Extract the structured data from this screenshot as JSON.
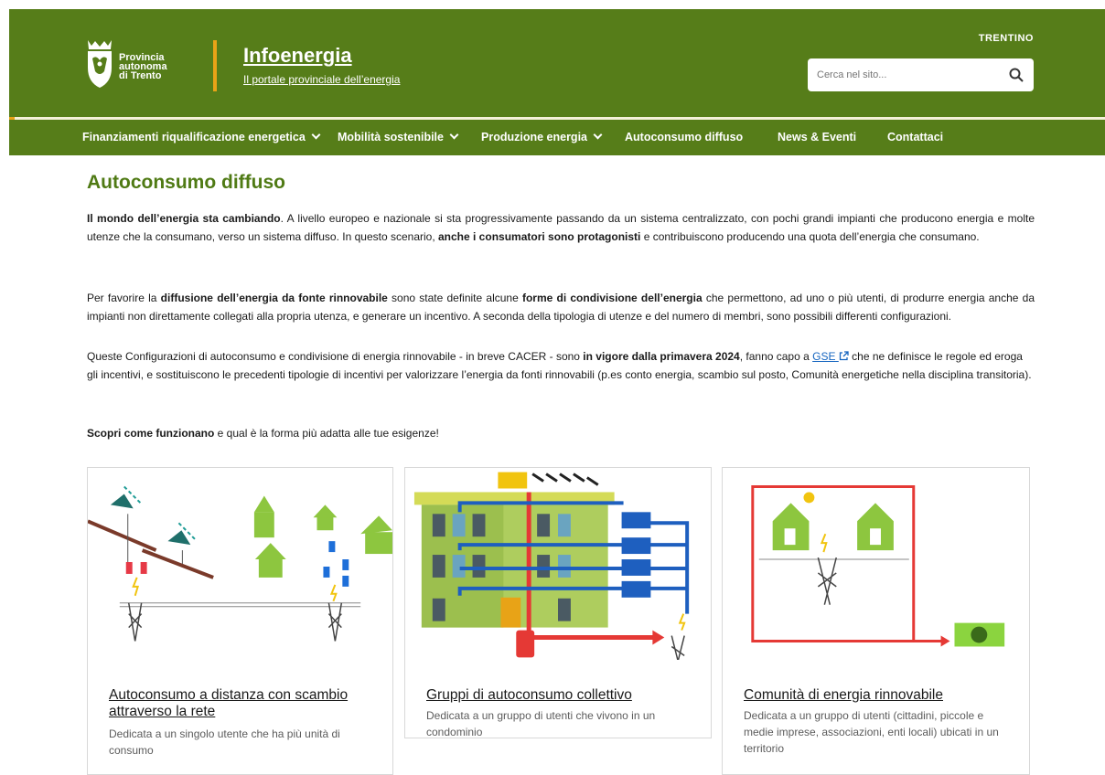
{
  "header": {
    "logo_lines": [
      "Provincia",
      "autonoma",
      "di Trento"
    ],
    "site_title": "Infoenergia",
    "site_subtitle": "Il portale provinciale dell’energia",
    "brand": "TRENTINO",
    "search": {
      "placeholder": "Cerca nel sito..."
    }
  },
  "nav": {
    "items": [
      {
        "label": "Finanziamenti riqualificazione energetica",
        "dropdown": true
      },
      {
        "label": "Mobilità sostenibile",
        "dropdown": true
      },
      {
        "label": "Produzione energia",
        "dropdown": true
      },
      {
        "label": "Autoconsumo diffuso",
        "dropdown": false
      },
      {
        "label": "News & Eventi",
        "dropdown": false
      },
      {
        "label": "Contattaci",
        "dropdown": false
      }
    ]
  },
  "main": {
    "title": "Autoconsumo diffuso",
    "p1": {
      "b1": "Il mondo dell’energia sta cambiando",
      "t1": ". A livello europeo e nazionale si sta progressivamente passando da un sistema centralizzato, con pochi grandi impianti che producono energia e molte utenze che la consumano, verso un sistema diffuso. In questo scenario, ",
      "b2": "anche i consumatori sono protagonisti",
      "t2": " e contribuiscono producendo una quota dell’energia che consumano."
    },
    "p2": {
      "t1": "Per favorire la ",
      "b1": "diffusione dell’energia da fonte rinnovabile",
      "t2": " sono state definite alcune ",
      "b2": "forme di condivisione dell’energia",
      "t3": " che permettono, ad uno o più utenti, di produrre energia anche da impianti non direttamente collegati alla propria utenza, e generare un incentivo. A seconda della tipologia di utenze e del numero di membri, sono possibili differenti configurazioni."
    },
    "p3": {
      "t1": "Queste Configurazioni di autoconsumo e condivisione di energia rinnovabile - in breve CACER - sono ",
      "b1": "in vigore dalla primavera 2024",
      "t2": ", fanno capo a ",
      "link": "GSE",
      "t3": " che ne definisce le regole ed eroga gli incentivi, e sostituiscono le precedenti tipologie di incentivi per valorizzare l’energia da fonti rinnovabili (p.es conto energia, scambio sul posto, Comunità energetiche nella disciplina transitoria)."
    },
    "p4": {
      "b1": "Scopri come funzionano",
      "t1": " e qual è la forma più adatta alle tue esigenze!"
    }
  },
  "cards": [
    {
      "title": "Autoconsumo a distanza con scambio attraverso la rete",
      "desc": "Dedicata a un singolo utente che ha più unità di consumo"
    },
    {
      "title": "Gruppi di autoconsumo collettivo",
      "desc": "Dedicata a un gruppo di utenti che vivono in un condominio"
    },
    {
      "title": "Comunità di energia rinnovabile",
      "desc": "Dedicata a un gruppo di utenti (cittadini, piccole e medie imprese, associazioni, enti locali) ubicati in un territorio"
    }
  ],
  "colors": {
    "header_green": "#567d19",
    "accent_orange": "#e8a317",
    "title_green": "#4f7a14"
  }
}
